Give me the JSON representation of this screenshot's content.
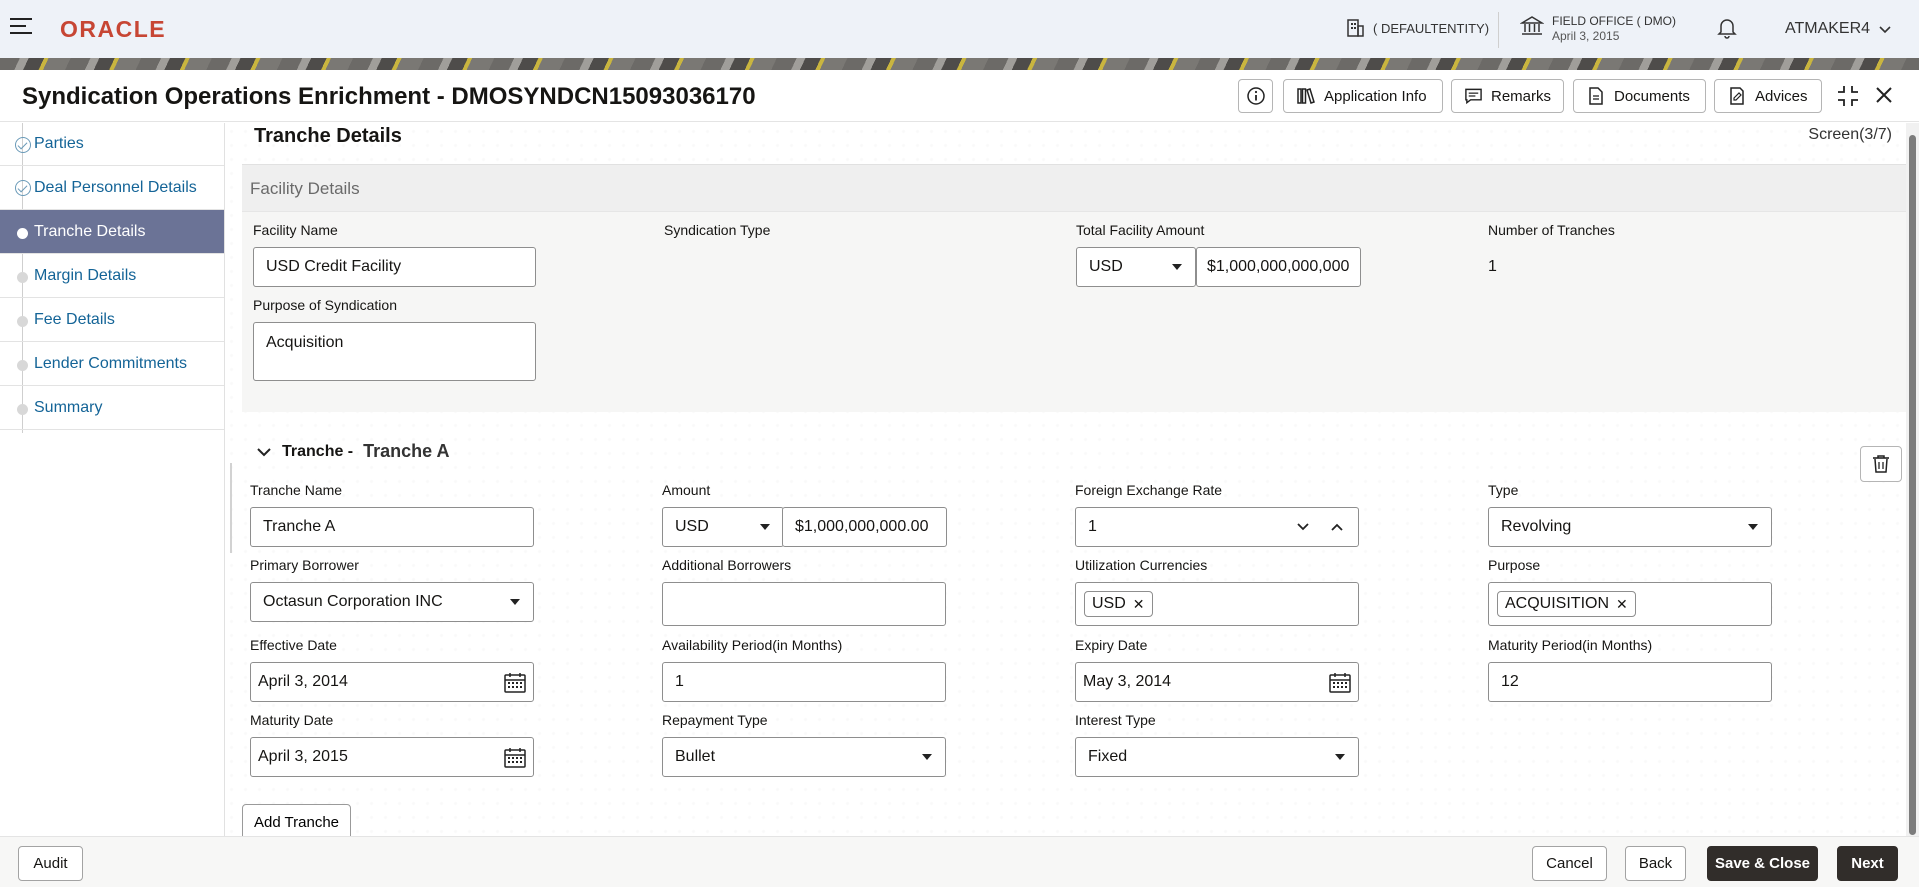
{
  "header": {
    "logo": "ORACLE",
    "entity": "( DEFAULTENTITY)",
    "office_name": "FIELD OFFICE ( DMO)",
    "office_date": "April 3, 2015",
    "user": "ATMAKER4"
  },
  "titlebar": {
    "title": "Syndication Operations Enrichment - DMOSYNDCN15093036170",
    "application_info": "Application Info",
    "remarks": "Remarks",
    "documents": "Documents",
    "advices": "Advices"
  },
  "sidebar": {
    "items": [
      {
        "label": "Parties",
        "state": "done"
      },
      {
        "label": "Deal Personnel Details",
        "state": "done"
      },
      {
        "label": "Tranche Details",
        "state": "active"
      },
      {
        "label": "Margin Details",
        "state": "pending"
      },
      {
        "label": "Fee Details",
        "state": "pending"
      },
      {
        "label": "Lender Commitments",
        "state": "pending"
      },
      {
        "label": "Summary",
        "state": "pending"
      }
    ]
  },
  "main": {
    "section_title": "Tranche Details",
    "screen": "Screen(3/7)"
  },
  "facility": {
    "header": "Facility Details",
    "name_label": "Facility Name",
    "name_value": "USD Credit Facility",
    "syndication_type_label": "Syndication Type",
    "total_amount_label": "Total Facility Amount",
    "total_currency": "USD",
    "total_amount": "$1,000,000,000,000",
    "num_tranches_label": "Number of Tranches",
    "num_tranches": "1",
    "purpose_label": "Purpose of Syndication",
    "purpose_value": "Acquisition"
  },
  "tranche": {
    "heading": "Tranche -",
    "name": "Tranche A",
    "tranche_name_label": "Tranche Name",
    "tranche_name_value": "Tranche A",
    "amount_label": "Amount",
    "amount_currency": "USD",
    "amount_value": "$1,000,000,000.00",
    "fx_label": "Foreign Exchange Rate",
    "fx_value": "1",
    "type_label": "Type",
    "type_value": "Revolving",
    "primary_borrower_label": "Primary Borrower",
    "primary_borrower_value": "Octasun Corporation INC",
    "additional_borrowers_label": "Additional Borrowers",
    "additional_borrowers_value": "",
    "util_currencies_label": "Utilization Currencies",
    "util_currency_chip": "USD",
    "purpose_label": "Purpose",
    "purpose_chip": "ACQUISITION",
    "effective_date_label": "Effective Date",
    "effective_date_value": "April 3, 2014",
    "availability_label": "Availability Period(in Months)",
    "availability_value": "1",
    "expiry_date_label": "Expiry Date",
    "expiry_date_value": "May 3, 2014",
    "maturity_period_label": "Maturity Period(in Months)",
    "maturity_period_value": "12",
    "maturity_date_label": "Maturity Date",
    "maturity_date_value": "April 3, 2015",
    "repayment_type_label": "Repayment Type",
    "repayment_type_value": "Bullet",
    "interest_type_label": "Interest Type",
    "interest_type_value": "Fixed",
    "add_tranche": "Add Tranche"
  },
  "footer": {
    "audit": "Audit",
    "cancel": "Cancel",
    "back": "Back",
    "save_close": "Save & Close",
    "next": "Next"
  }
}
